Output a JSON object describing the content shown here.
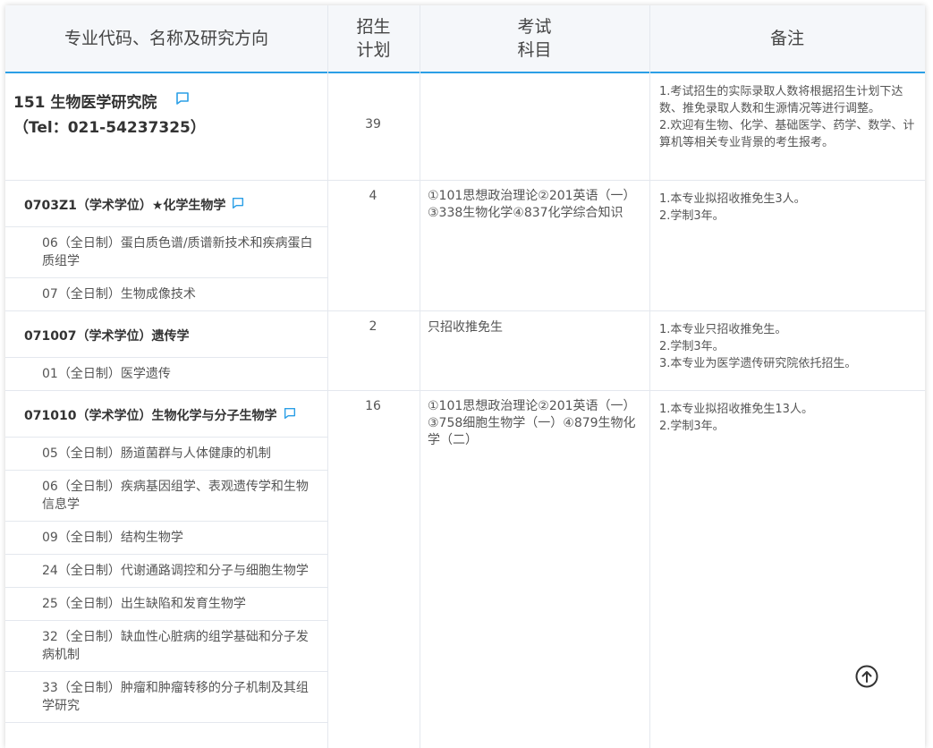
{
  "header": {
    "col1": "专业代码、名称及研究方向",
    "col2_line1": "招生",
    "col2_line2": "计划",
    "col3_line1": "考试",
    "col3_line2": "科目",
    "col4": "备注"
  },
  "institute": {
    "name": "151 生物医学研究院",
    "tel": "（Tel：021-54237325）",
    "plan": "39",
    "notes": [
      "1.考试招生的实际录取人数将根据招生计划下达数、推免录取人数和生源情况等进行调整。",
      "2.欢迎有生物、化学、基础医学、药学、数学、计算机等相关专业背景的考生报考。"
    ]
  },
  "majors": [
    {
      "title": "0703Z1（学术学位）★化学生物学",
      "plan": "4",
      "exam": [
        "①101思想政治理论②201英语（一）",
        "③338生物化学④837化学综合知识"
      ],
      "notes": [
        "1.本专业拟招收推免生3人。",
        "2.学制3年。"
      ],
      "directions": [
        "06（全日制）蛋白质色谱/质谱新技术和疾病蛋白质组学",
        "07（全日制）生物成像技术"
      ]
    },
    {
      "title": "071007（学术学位）遗传学",
      "plan": "2",
      "exam": [
        "只招收推免生"
      ],
      "notes": [
        "1.本专业只招收推免生。",
        "2.学制3年。",
        "3.本专业为医学遗传研究院依托招生。"
      ],
      "directions": [
        "01（全日制）医学遗传"
      ]
    },
    {
      "title": "071010（学术学位）生物化学与分子生物学",
      "plan": "16",
      "exam": [
        "①101思想政治理论②201英语（一）③758细胞生物学（一）④879生物化学（二）"
      ],
      "notes": [
        "1.本专业拟招收推免生13人。",
        "2.学制3年。"
      ],
      "directions": [
        "05（全日制）肠道菌群与人体健康的机制",
        "06（全日制）疾病基因组学、表观遗传学和生物信息学",
        "09（全日制）结构生物学",
        "24（全日制）代谢通路调控和分子与细胞生物学",
        "25（全日制）出生缺陷和发育生物学",
        "32（全日制）缺血性心脏病的组学基础和分子发病机制",
        "33（全日制）肿瘤和肿瘤转移的分子机制及其组学研究"
      ]
    }
  ],
  "icons": {
    "comment": "comment-icon",
    "back_to_top": "arrow-up-circle-icon"
  },
  "colors": {
    "accent": "#2b9fe6",
    "header_bg": "#f5f7fa",
    "border": "#e4e8ee"
  }
}
